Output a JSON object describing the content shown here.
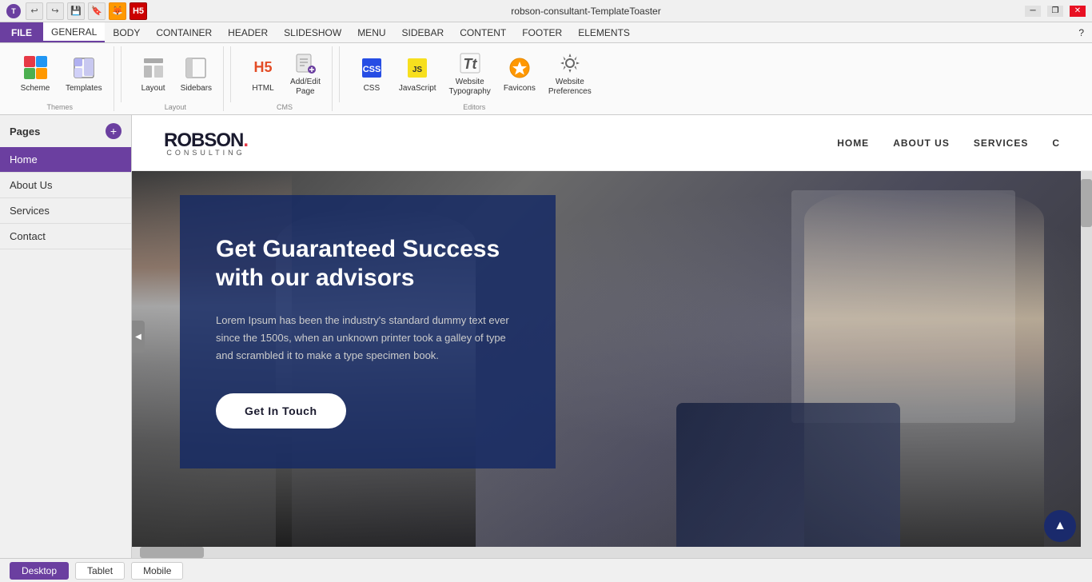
{
  "window": {
    "title": "robson-consultant-TemplateToaster",
    "min_btn": "─",
    "max_btn": "❐",
    "close_btn": "✕"
  },
  "toolbar_icons": {
    "undo": "↩",
    "redo": "↪",
    "save": "💾",
    "icon4": "🔖",
    "icon5": "🦊",
    "icon6": "🔴"
  },
  "menu": {
    "file": "FILE",
    "general": "GENERAL",
    "body": "BODY",
    "container": "CONTAINER",
    "header": "HEADER",
    "slideshow": "SLIDESHOW",
    "menu": "MENU",
    "sidebar": "SIDEBAR",
    "content": "CONTENT",
    "footer": "FOOTER",
    "elements": "ELEMENTS",
    "help": "?"
  },
  "toolbar": {
    "scheme_label": "Scheme",
    "templates_label": "Templates",
    "layout_label": "Layout",
    "sidebars_label": "Sidebars",
    "html_label": "HTML",
    "addedit_label": "Add/Edit\nPage",
    "css_label": "CSS",
    "javascript_label": "JavaScript",
    "typography_label": "Website\nTypography",
    "favicons_label": "Favicons",
    "preferences_label": "Website\nPreferences",
    "themes_group": "Themes",
    "layout_group": "Layout",
    "cms_group": "CMS",
    "editors_group": "Editors"
  },
  "sidebar": {
    "title": "Pages",
    "add_tooltip": "+",
    "items": [
      {
        "label": "Home",
        "active": true
      },
      {
        "label": "About Us",
        "active": false
      },
      {
        "label": "Services",
        "active": false
      },
      {
        "label": "Contact",
        "active": false
      }
    ]
  },
  "preview": {
    "brand_name": "ROBSON.",
    "brand_sub": "CONSULTING",
    "dot": ".",
    "nav_links": [
      "HOME",
      "ABOUT US",
      "SERVICES",
      "C"
    ],
    "hero_title": "Get Guaranteed Success with our advisors",
    "hero_desc": "Lorem Ipsum has been the industry's standard dummy text ever since the 1500s, when an unknown printer took a galley of type and scrambled it to make a type specimen book.",
    "hero_btn": "Get In Touch"
  },
  "bottom_bar": {
    "desktop_label": "Desktop",
    "tablet_label": "Tablet",
    "mobile_label": "Mobile"
  },
  "collapse_icon": "◀"
}
